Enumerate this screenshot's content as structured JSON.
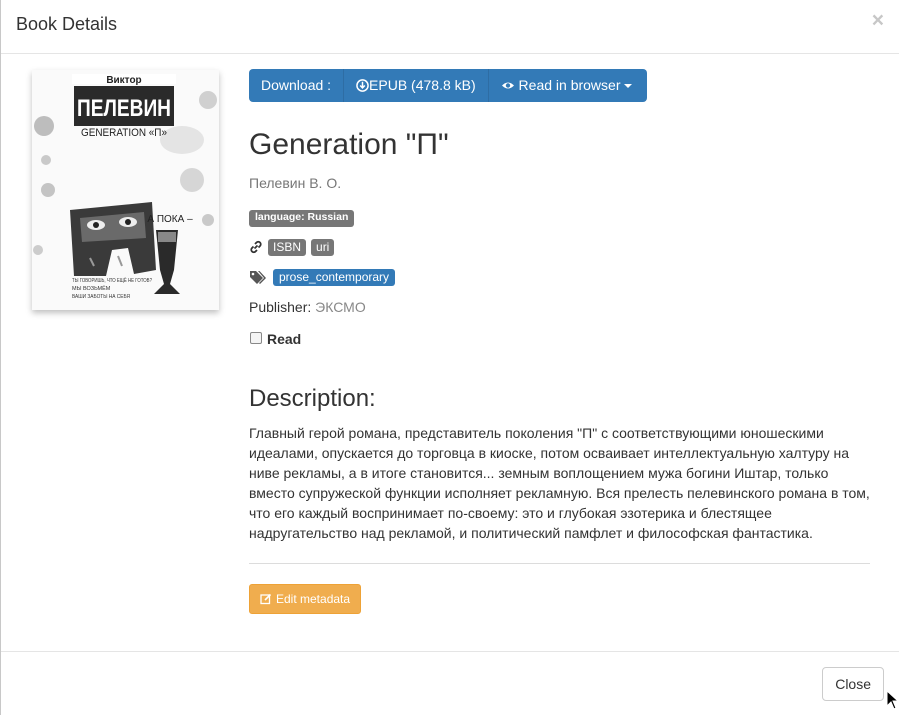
{
  "modal": {
    "title": "Book Details",
    "close_x": "×",
    "close_button": "Close"
  },
  "download": {
    "label": "Download :",
    "epub": "EPUB (478.8 kB)",
    "read_browser": "Read in browser"
  },
  "book": {
    "title": "Generation \"П\"",
    "author": "Пелевин В. О.",
    "language_badge": "language: Russian",
    "identifiers": [
      "ISBN",
      "uri"
    ],
    "tags": [
      "prose_contemporary"
    ],
    "publisher_label": "Publisher:",
    "publisher": "ЭКСМО",
    "read_label": "Read",
    "read_checked": false
  },
  "cover": {
    "author_small": "Виктор",
    "author_big": "ПЕЛЕВИН",
    "subtitle": "GENERATION «П»",
    "a_poka": "А ПОКА –",
    "tagline": "ТЫ ГОВОРИШЬ, ЧТО ЕЩЁ НЕ ГОТОВ? МЫ ВОЗЬМЁМ ВАШИ ЗАБОТЫ НА СЕБЯ"
  },
  "description": {
    "heading": "Description:",
    "text": "Главный герой романа, представитель поколения \"П\" с соответствующими юношескими идеалами, опускается до торговца в киоске, потом осваивает интеллектуальную халтуру на ниве рекламы, а в итоге становится... земным воплощением мужа богини Иштар, только вместо супружеской функции исполняет рекламную. Вся прелесть пелевинского романа в том, что его каждый воспринимает по-своему: это и глубокая эзотерика и блестящее надругательство над рекламой, и политический памфлет и философская фантастика."
  },
  "actions": {
    "edit_metadata": "Edit metadata"
  },
  "colors": {
    "primary": "#337ab7",
    "warning": "#f0ad4e",
    "badge_gray": "#777777"
  }
}
